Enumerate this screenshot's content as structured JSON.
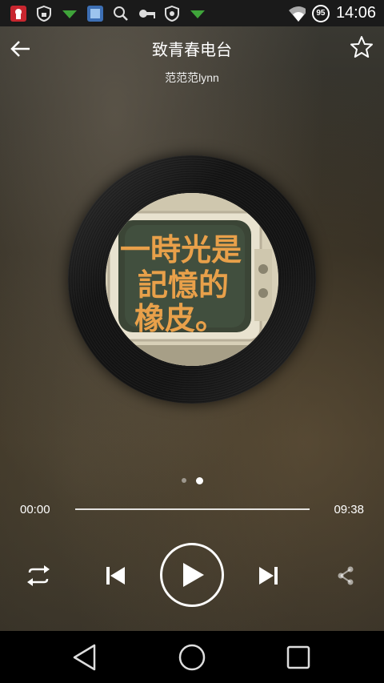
{
  "status_bar": {
    "time": "14:06",
    "battery": "95",
    "icons": [
      "app-notification-icon",
      "shield-icon",
      "download-icon",
      "app-icon",
      "search-icon",
      "key-icon",
      "shield-icon",
      "download-icon",
      "wifi-icon",
      "battery-icon"
    ]
  },
  "header": {
    "title": "致青春电台",
    "artist": "范范范lynn"
  },
  "cover": {
    "text_lines": [
      "一時光是",
      "記憶的",
      "橡皮。"
    ]
  },
  "pager": {
    "count": 2,
    "active_index": 1
  },
  "player": {
    "current_time": "00:00",
    "duration": "09:38",
    "progress": 0.0
  },
  "colors": {
    "accent": "#ffffff",
    "statusbar": "#1a1a1a",
    "navbar": "#000000"
  }
}
